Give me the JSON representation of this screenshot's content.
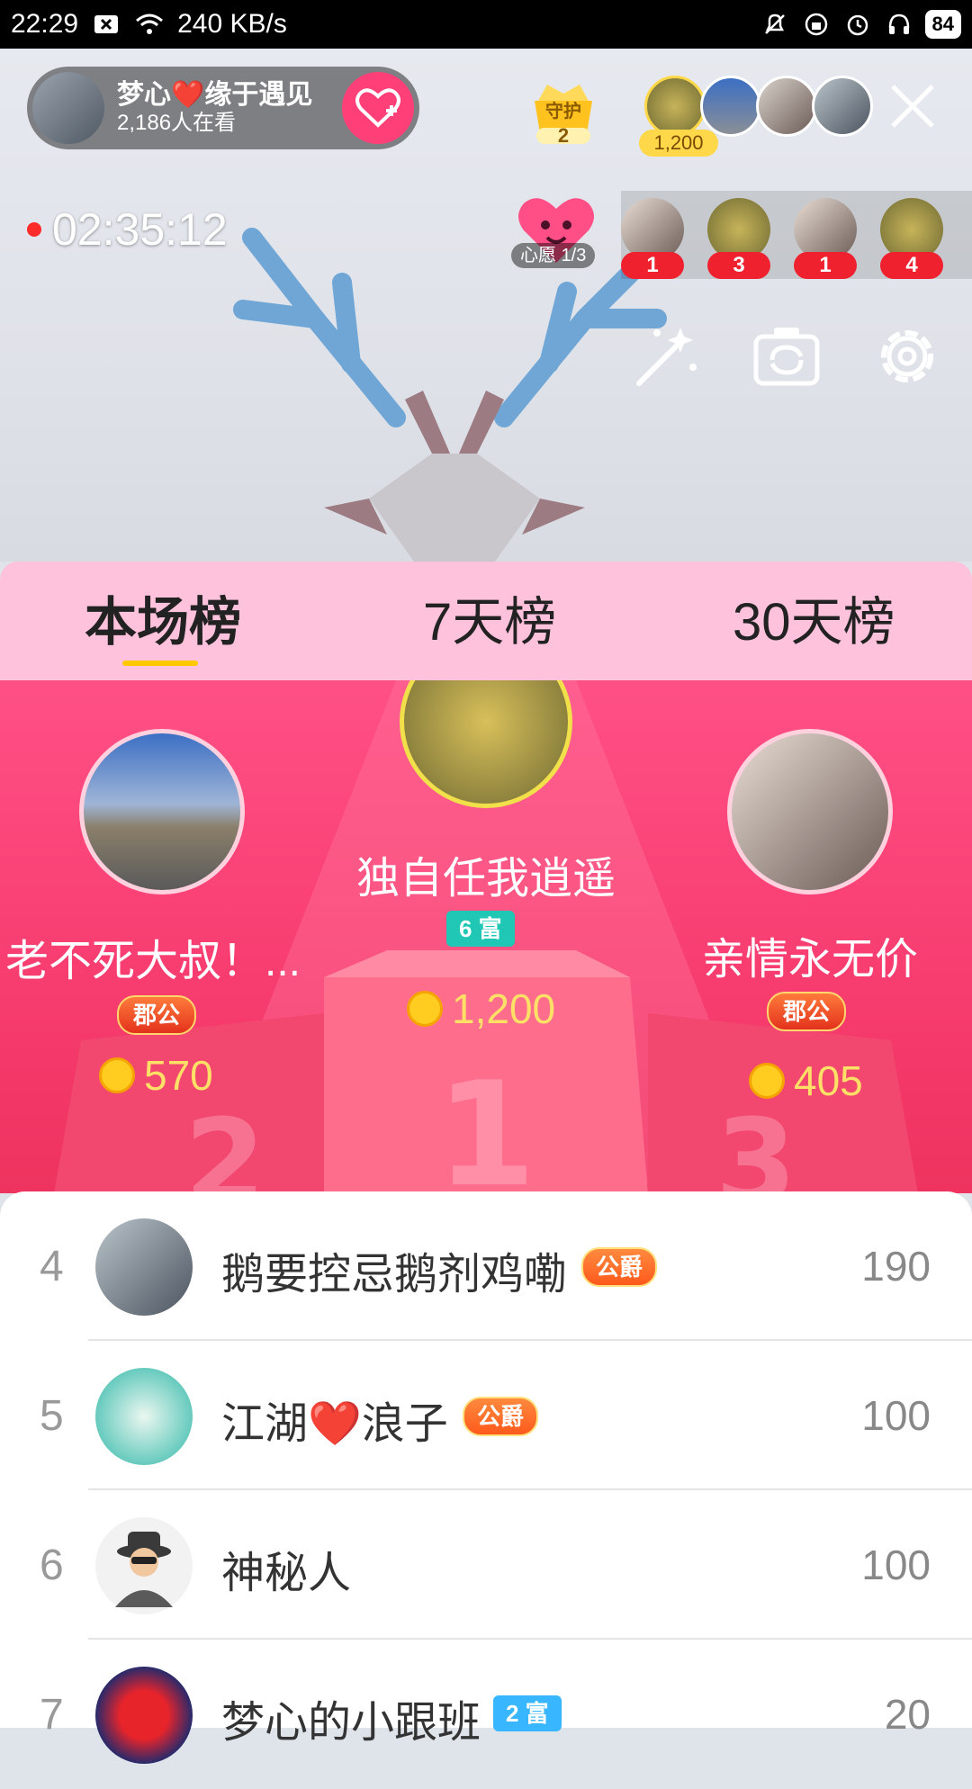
{
  "status_bar": {
    "time": "22:29",
    "net_speed": "240 KB/s",
    "battery": "84"
  },
  "host": {
    "name": "梦心❤️缘于遇见",
    "viewers": "2,186人在看"
  },
  "guard": {
    "label": "守护",
    "count": "2"
  },
  "top_viewer_coins": "1,200",
  "timer": "02:35:12",
  "wish": {
    "label": "心愿 1/3"
  },
  "gift_counts": [
    "1",
    "3",
    "1",
    "4"
  ],
  "tabs": [
    "本场榜",
    "7天榜",
    "30天榜"
  ],
  "podium": {
    "first": {
      "name": "独自任我逍遥",
      "badge": "6 富",
      "score": "1,200"
    },
    "second": {
      "name": "老不死大叔！...",
      "badge": "郡公",
      "score": "570"
    },
    "third": {
      "name": "亲情永无价",
      "badge": "郡公",
      "score": "405"
    }
  },
  "list": [
    {
      "rank": "4",
      "name": "鹅要控忌鹅剂鸡嘞",
      "badge": "公爵",
      "score": "190"
    },
    {
      "rank": "5",
      "name": "江湖❤️浪子",
      "badge": "公爵",
      "score": "100"
    },
    {
      "rank": "6",
      "name": "神秘人",
      "badge": "",
      "score": "100"
    },
    {
      "rank": "7",
      "name": "梦心的小跟班",
      "badge": "2 富",
      "score": "20"
    }
  ],
  "colors": {
    "accent_pink": "#ff3f77",
    "tab_bg": "#ffc2dc",
    "podium_bg": "#f73c6f",
    "gold": "#ffe066"
  }
}
